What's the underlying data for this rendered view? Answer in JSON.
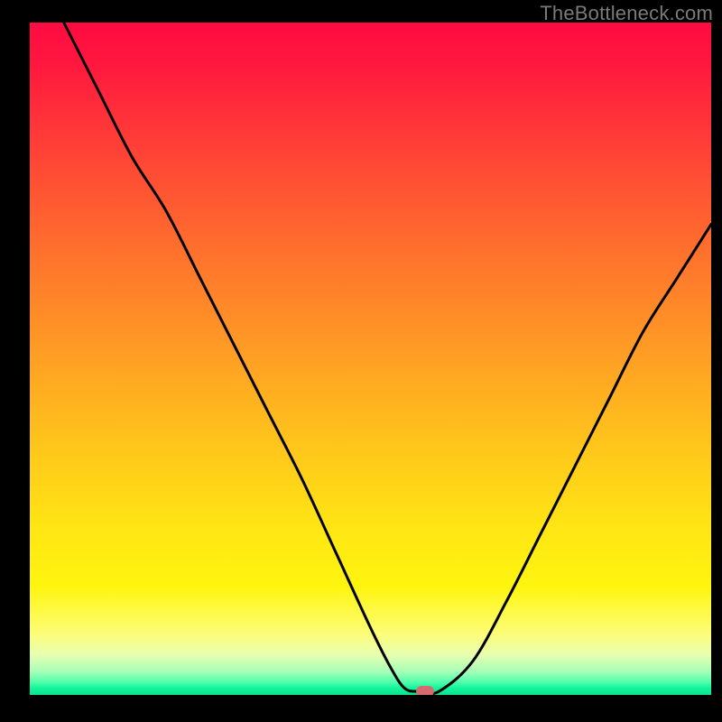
{
  "watermark": "TheBottleneck.com",
  "chart_data": {
    "type": "line",
    "title": "",
    "xlabel": "",
    "ylabel": "",
    "xlim": [
      0,
      100
    ],
    "ylim": [
      0,
      100
    ],
    "grid": false,
    "legend": false,
    "series": [
      {
        "name": "bottleneck-curve",
        "x": [
          5,
          10,
          15,
          20,
          25,
          30,
          35,
          40,
          45,
          50,
          53,
          55,
          57,
          60,
          65,
          70,
          75,
          80,
          85,
          90,
          95,
          100
        ],
        "y": [
          100,
          90,
          80,
          72,
          62,
          52,
          42,
          32,
          21,
          10,
          4,
          1,
          0.5,
          0.5,
          5,
          14,
          24,
          34,
          44,
          54,
          62,
          70
        ]
      }
    ],
    "marker": {
      "x": 58,
      "y": 0.5
    },
    "background_gradient": {
      "top": "#ff0b42",
      "mid": "#ffe514",
      "bottom": "#0ce28e"
    }
  }
}
